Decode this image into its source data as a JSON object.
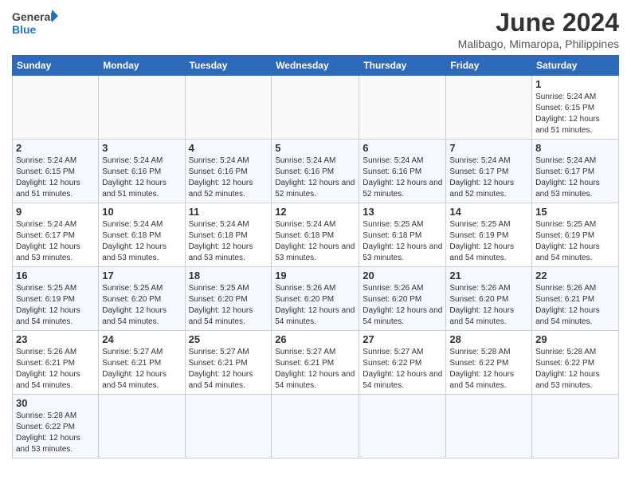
{
  "header": {
    "logo_general": "General",
    "logo_blue": "Blue",
    "month": "June 2024",
    "location": "Malibago, Mimaropa, Philippines"
  },
  "weekdays": [
    "Sunday",
    "Monday",
    "Tuesday",
    "Wednesday",
    "Thursday",
    "Friday",
    "Saturday"
  ],
  "weeks": [
    [
      {
        "day": "",
        "info": ""
      },
      {
        "day": "",
        "info": ""
      },
      {
        "day": "",
        "info": ""
      },
      {
        "day": "",
        "info": ""
      },
      {
        "day": "",
        "info": ""
      },
      {
        "day": "",
        "info": ""
      },
      {
        "day": "1",
        "info": "Sunrise: 5:24 AM\nSunset: 6:15 PM\nDaylight: 12 hours and 51 minutes."
      }
    ],
    [
      {
        "day": "2",
        "info": "Sunrise: 5:24 AM\nSunset: 6:15 PM\nDaylight: 12 hours and 51 minutes."
      },
      {
        "day": "3",
        "info": "Sunrise: 5:24 AM\nSunset: 6:16 PM\nDaylight: 12 hours and 51 minutes."
      },
      {
        "day": "4",
        "info": "Sunrise: 5:24 AM\nSunset: 6:16 PM\nDaylight: 12 hours and 52 minutes."
      },
      {
        "day": "5",
        "info": "Sunrise: 5:24 AM\nSunset: 6:16 PM\nDaylight: 12 hours and 52 minutes."
      },
      {
        "day": "6",
        "info": "Sunrise: 5:24 AM\nSunset: 6:16 PM\nDaylight: 12 hours and 52 minutes."
      },
      {
        "day": "7",
        "info": "Sunrise: 5:24 AM\nSunset: 6:17 PM\nDaylight: 12 hours and 52 minutes."
      },
      {
        "day": "8",
        "info": "Sunrise: 5:24 AM\nSunset: 6:17 PM\nDaylight: 12 hours and 53 minutes."
      }
    ],
    [
      {
        "day": "9",
        "info": "Sunrise: 5:24 AM\nSunset: 6:17 PM\nDaylight: 12 hours and 53 minutes."
      },
      {
        "day": "10",
        "info": "Sunrise: 5:24 AM\nSunset: 6:18 PM\nDaylight: 12 hours and 53 minutes."
      },
      {
        "day": "11",
        "info": "Sunrise: 5:24 AM\nSunset: 6:18 PM\nDaylight: 12 hours and 53 minutes."
      },
      {
        "day": "12",
        "info": "Sunrise: 5:24 AM\nSunset: 6:18 PM\nDaylight: 12 hours and 53 minutes."
      },
      {
        "day": "13",
        "info": "Sunrise: 5:25 AM\nSunset: 6:18 PM\nDaylight: 12 hours and 53 minutes."
      },
      {
        "day": "14",
        "info": "Sunrise: 5:25 AM\nSunset: 6:19 PM\nDaylight: 12 hours and 54 minutes."
      },
      {
        "day": "15",
        "info": "Sunrise: 5:25 AM\nSunset: 6:19 PM\nDaylight: 12 hours and 54 minutes."
      }
    ],
    [
      {
        "day": "16",
        "info": "Sunrise: 5:25 AM\nSunset: 6:19 PM\nDaylight: 12 hours and 54 minutes."
      },
      {
        "day": "17",
        "info": "Sunrise: 5:25 AM\nSunset: 6:20 PM\nDaylight: 12 hours and 54 minutes."
      },
      {
        "day": "18",
        "info": "Sunrise: 5:25 AM\nSunset: 6:20 PM\nDaylight: 12 hours and 54 minutes."
      },
      {
        "day": "19",
        "info": "Sunrise: 5:26 AM\nSunset: 6:20 PM\nDaylight: 12 hours and 54 minutes."
      },
      {
        "day": "20",
        "info": "Sunrise: 5:26 AM\nSunset: 6:20 PM\nDaylight: 12 hours and 54 minutes."
      },
      {
        "day": "21",
        "info": "Sunrise: 5:26 AM\nSunset: 6:20 PM\nDaylight: 12 hours and 54 minutes."
      },
      {
        "day": "22",
        "info": "Sunrise: 5:26 AM\nSunset: 6:21 PM\nDaylight: 12 hours and 54 minutes."
      }
    ],
    [
      {
        "day": "23",
        "info": "Sunrise: 5:26 AM\nSunset: 6:21 PM\nDaylight: 12 hours and 54 minutes."
      },
      {
        "day": "24",
        "info": "Sunrise: 5:27 AM\nSunset: 6:21 PM\nDaylight: 12 hours and 54 minutes."
      },
      {
        "day": "25",
        "info": "Sunrise: 5:27 AM\nSunset: 6:21 PM\nDaylight: 12 hours and 54 minutes."
      },
      {
        "day": "26",
        "info": "Sunrise: 5:27 AM\nSunset: 6:21 PM\nDaylight: 12 hours and 54 minutes."
      },
      {
        "day": "27",
        "info": "Sunrise: 5:27 AM\nSunset: 6:22 PM\nDaylight: 12 hours and 54 minutes."
      },
      {
        "day": "28",
        "info": "Sunrise: 5:28 AM\nSunset: 6:22 PM\nDaylight: 12 hours and 54 minutes."
      },
      {
        "day": "29",
        "info": "Sunrise: 5:28 AM\nSunset: 6:22 PM\nDaylight: 12 hours and 53 minutes."
      }
    ],
    [
      {
        "day": "30",
        "info": "Sunrise: 5:28 AM\nSunset: 6:22 PM\nDaylight: 12 hours and 53 minutes."
      },
      {
        "day": "",
        "info": ""
      },
      {
        "day": "",
        "info": ""
      },
      {
        "day": "",
        "info": ""
      },
      {
        "day": "",
        "info": ""
      },
      {
        "day": "",
        "info": ""
      },
      {
        "day": "",
        "info": ""
      }
    ]
  ]
}
